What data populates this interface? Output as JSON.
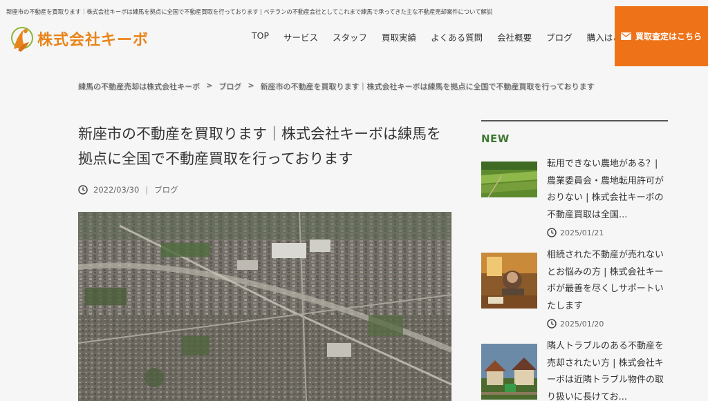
{
  "header": {
    "caption": "新座市の不動産を買取ります｜株式会社キーボは練馬を拠点に全国で不動産買取を行っております | ベテランの不動産会社としてこれまで練馬で承ってきた主な不動産売却案件について解説",
    "logo_text": "株式会社キーボ",
    "nav": [
      "TOP",
      "サービス",
      "スタッフ",
      "買取実績",
      "よくある質問",
      "会社概要",
      "ブログ",
      "購入はこちら"
    ],
    "cta_label": "買取査定はこちら",
    "accent": "#ee7218"
  },
  "breadcrumb": [
    "練馬の不動産売却は株式会社キーボ",
    "ブログ",
    "新座市の不動産を買取ります｜株式会社キーボは練馬を拠点に全国で不動産買取を行っております"
  ],
  "breadcrumb_sep": ">",
  "post": {
    "title": "新座市の不動産を買取ります｜株式会社キーボは練馬を拠点に全国で不動産買取を行っております",
    "date": "2022/03/30",
    "category": "ブログ"
  },
  "sidebar": {
    "heading": "NEW",
    "posts": [
      {
        "title": "転用できない農地がある？| 農業委員会・農地転用許可がおりない | 株式会社キーボの不動産買取は全国...",
        "date": "2025/01/21"
      },
      {
        "title": "相続された不動産が売れないとお悩みの方 | 株式会社キーボが最善を尽くしサポートいたします",
        "date": "2025/01/20"
      },
      {
        "title": "隣人トラブルのある不動産を売却されたい方 | 株式会社キーボは近隣トラブル物件の取り扱いに長けてお...",
        "date": ""
      }
    ]
  }
}
